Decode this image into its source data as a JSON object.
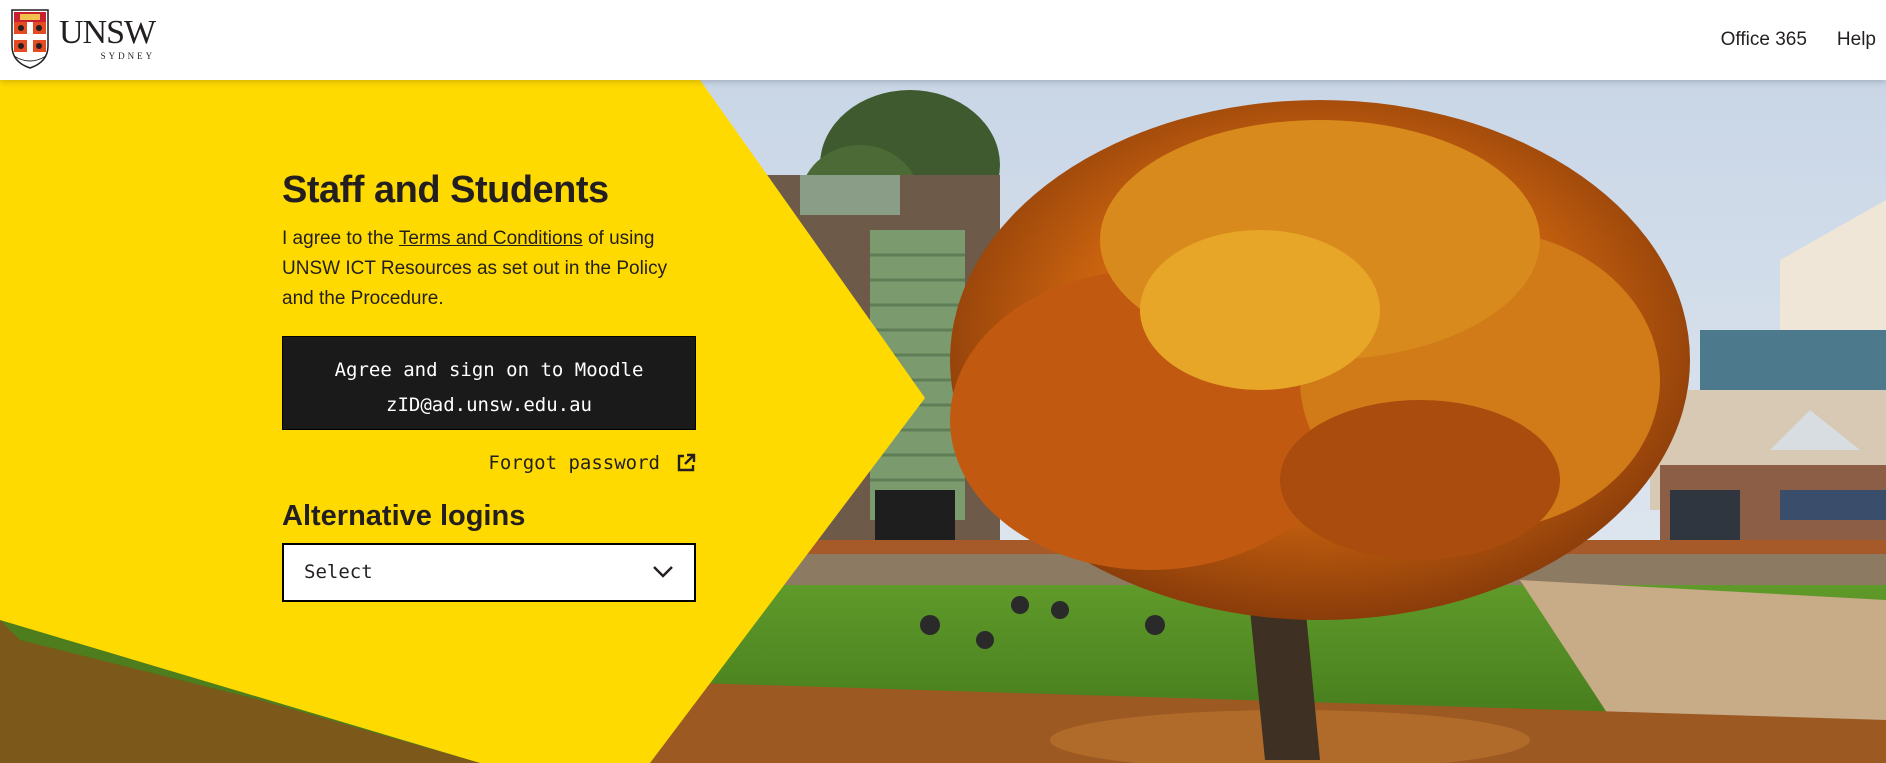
{
  "header": {
    "logo": {
      "name": "UNSW",
      "subtitle": "SYDNEY"
    },
    "nav": [
      {
        "label": "Office 365"
      },
      {
        "label": "Help"
      }
    ]
  },
  "login": {
    "title": "Staff and Students",
    "agree_prefix": "I agree to the ",
    "terms_link": "Terms and Conditions",
    "agree_suffix": " of using UNSW ICT Resources as set out in the Policy and the Procedure.",
    "signon_line1": "Agree and sign on to Moodle",
    "signon_line2": "zID@ad.unsw.edu.au",
    "forgot": "Forgot password",
    "alt_title": "Alternative logins",
    "alt_select": "Select"
  },
  "colors": {
    "accent_yellow": "#FFDA00",
    "button_dark": "#1A1A1A"
  },
  "icons": {
    "forgot": "external-link-icon",
    "select": "chevron-down-icon"
  }
}
